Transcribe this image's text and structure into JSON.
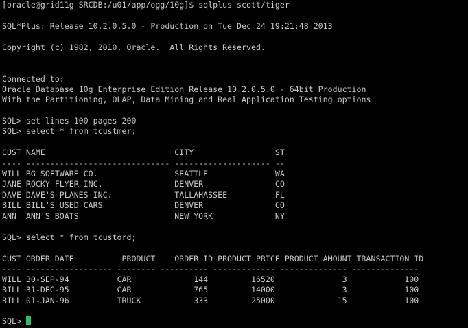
{
  "window": {
    "background": "#000000",
    "text_color": "#c8c8c8",
    "cursor_color": "#22c65a"
  },
  "session": {
    "shell_prompt": "[oracle@grid11g SRCDB:/u01/app/ogg/10g]$ sqlplus scott/tiger",
    "banner": "SQL*Plus: Release 10.2.0.5.0 - Production on Tue Dec 24 19:21:48 2013",
    "copyright": "Copyright (c) 1982, 2010, Oracle.  All Rights Reserved.",
    "connected": "Connected to:",
    "db_version": "Oracle Database 10g Enterprise Edition Release 10.2.0.5.0 - 64bit Production",
    "db_options": "With the Partitioning, OLAP, Data Mining and Real Application Testing options",
    "cmd_set": "SQL> set lines 100 pages 200",
    "cmd_select1": "SQL> select * from tcustmer;",
    "cmd_select2": "SQL> select * from tcustord;",
    "final_prompt": "SQL> "
  },
  "tcustmer": {
    "header": "CUST NAME                           CITY                 ST",
    "separator": "---- ------------------------------ -------------------- --",
    "rows": [
      "WILL BG SOFTWARE CO.                SEATTLE              WA",
      "JANE ROCKY FLYER INC.               DENVER               CO",
      "DAVE DAVE'S PLANES INC.             TALLAHASSEE          FL",
      "BILL BILL'S USED CARS               DENVER               CO",
      "ANN  ANN'S BOATS                    NEW YORK             NY"
    ]
  },
  "tcustord": {
    "header": "CUST ORDER_DATE          PRODUCT_   ORDER_ID PRODUCT_PRICE PRODUCT_AMOUNT TRANSACTION_ID",
    "separator": "---- ------------------ -------- ---------- ------------- -------------- --------------",
    "rows": [
      "WILL 30-SEP-94          CAR             144         16520              3            100",
      "BILL 31-DEC-95          CAR             765         14000              3            100",
      "BILL 01-JAN-96          TRUCK           333         25000             15            100"
    ]
  }
}
